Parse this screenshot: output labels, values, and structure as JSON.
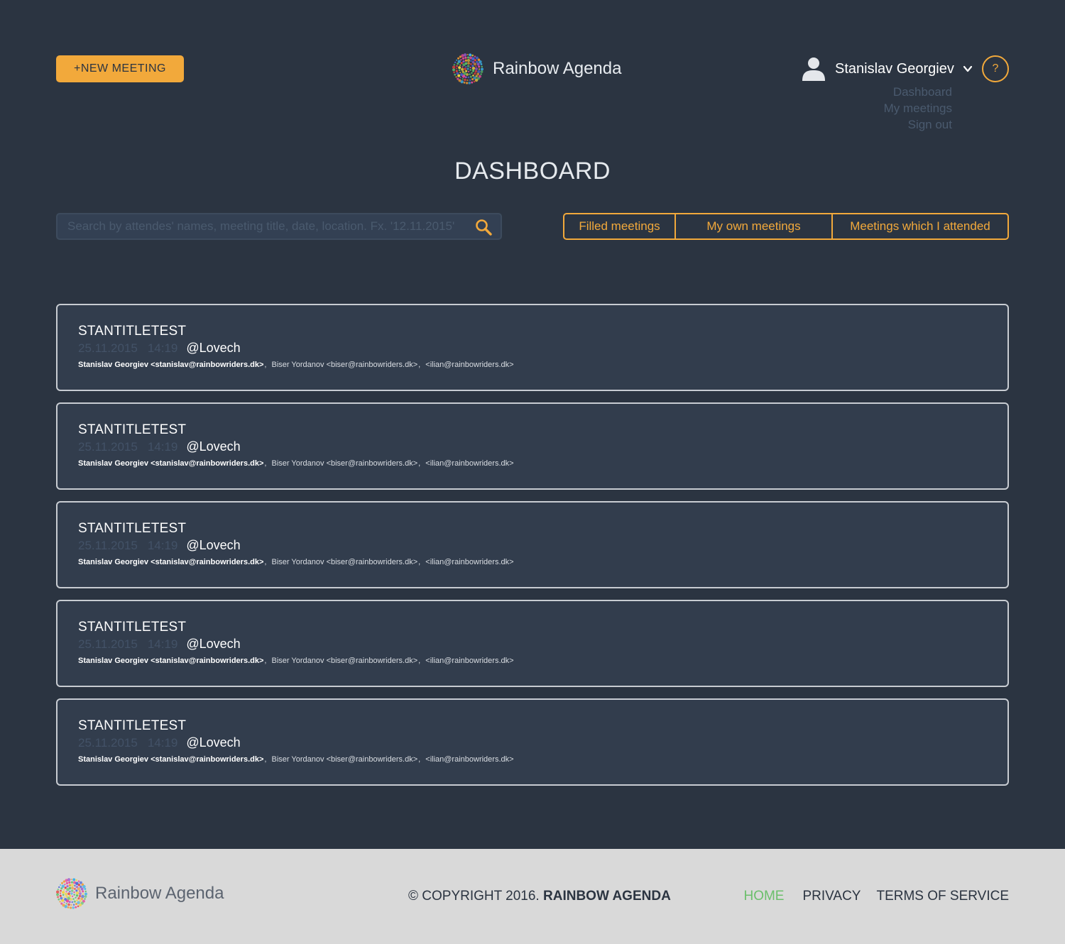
{
  "header": {
    "new_meeting_label": "+NEW MEETING",
    "brand_name": "Rainbow Agenda",
    "user_name": "Stanislav Georgiev",
    "help_label": "?",
    "user_menu": [
      "Dashboard",
      "My meetings",
      "Sign out"
    ]
  },
  "page_title": "DASHBOARD",
  "search": {
    "placeholder": "Search by attendes' names, meeting title, date, location. Fx. '12.11.2015'"
  },
  "filters": [
    "Filled meetings",
    "My own meetings",
    "Meetings which I attended"
  ],
  "meetings": [
    {
      "title": "STANTITLETEST",
      "date": "25.11.2015",
      "time": "14:19",
      "location": "@Lovech",
      "owner": "Stanislav Georgiev <stanislav@rainbowriders.dk>",
      "attendees": [
        "Biser Yordanov <biser@rainbowriders.dk>",
        "<ilian@rainbowriders.dk>"
      ]
    },
    {
      "title": "STANTITLETEST",
      "date": "25.11.2015",
      "time": "14:19",
      "location": "@Lovech",
      "owner": "Stanislav Georgiev <stanislav@rainbowriders.dk>",
      "attendees": [
        "Biser Yordanov <biser@rainbowriders.dk>",
        "<ilian@rainbowriders.dk>"
      ]
    },
    {
      "title": "STANTITLETEST",
      "date": "25.11.2015",
      "time": "14:19",
      "location": "@Lovech",
      "owner": "Stanislav Georgiev <stanislav@rainbowriders.dk>",
      "attendees": [
        "Biser Yordanov <biser@rainbowriders.dk>",
        "<ilian@rainbowriders.dk>"
      ]
    },
    {
      "title": "STANTITLETEST",
      "date": "25.11.2015",
      "time": "14:19",
      "location": "@Lovech",
      "owner": "Stanislav Georgiev <stanislav@rainbowriders.dk>",
      "attendees": [
        "Biser Yordanov <biser@rainbowriders.dk>",
        "<ilian@rainbowriders.dk>"
      ]
    },
    {
      "title": "STANTITLETEST",
      "date": "25.11.2015",
      "time": "14:19",
      "location": "@Lovech",
      "owner": "Stanislav Georgiev <stanislav@rainbowriders.dk>",
      "attendees": [
        "Biser Yordanov <biser@rainbowriders.dk>",
        "<ilian@rainbowriders.dk>"
      ]
    }
  ],
  "footer": {
    "brand_name": "Rainbow Agenda",
    "copyright_prefix": "© COPYRIGHT 2016.",
    "copyright_name": "RAINBOW AGENDA",
    "links": [
      "HOME",
      "PRIVACY",
      "TERMS OF SERVICE"
    ]
  },
  "colors": {
    "background": "#2b3441",
    "card_background": "#323d4d",
    "accent": "#f2a93b",
    "footer_background": "#d9d9d9",
    "footer_active_link": "#6bbf6b",
    "muted_text": "#4a5a6e"
  },
  "icons": {
    "logo": "rainbow-dot-globe-icon",
    "user": "user-silhouette-icon",
    "chevron": "chevron-down-icon",
    "search": "search-icon",
    "help": "help-icon"
  }
}
